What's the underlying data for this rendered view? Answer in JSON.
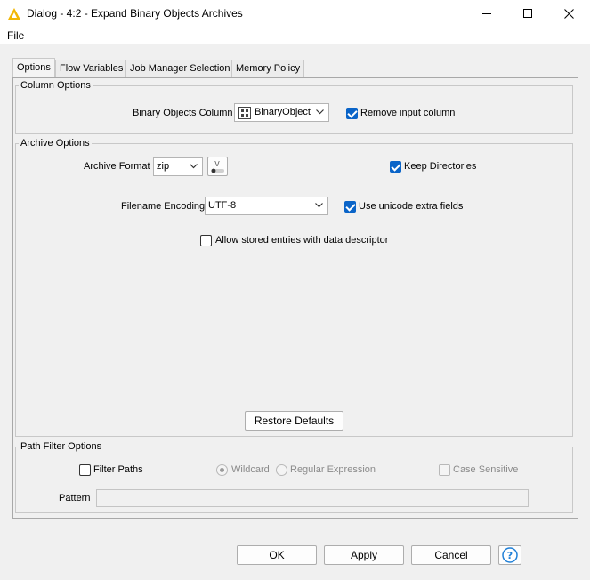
{
  "window": {
    "title": "Dialog - 4:2 - Expand Binary Objects Archives"
  },
  "menu": {
    "file": "File"
  },
  "tabs": [
    {
      "label": "Options",
      "active": true
    },
    {
      "label": "Flow Variables",
      "active": false
    },
    {
      "label": "Job Manager Selection",
      "active": false
    },
    {
      "label": "Memory Policy",
      "active": false
    }
  ],
  "column_options": {
    "title": "Column Options",
    "binary_column_label": "Binary Objects Column",
    "binary_column_value": "BinaryObject",
    "remove_input_label": "Remove input column",
    "remove_input_checked": true
  },
  "archive_options": {
    "title": "Archive Options",
    "format_label": "Archive Format",
    "format_value": "zip",
    "keep_dirs_label": "Keep Directories",
    "keep_dirs_checked": true,
    "encoding_label": "Filename Encoding",
    "encoding_value": "UTF-8",
    "unicode_label": "Use unicode extra fields",
    "unicode_checked": true,
    "allow_stored_label": "Allow stored entries with data descriptor",
    "allow_stored_checked": false,
    "restore_defaults": "Restore Defaults"
  },
  "path_filter": {
    "title": "Path Filter Options",
    "filter_paths_label": "Filter Paths",
    "filter_paths_checked": false,
    "wildcard_label": "Wildcard",
    "wildcard_selected": true,
    "regex_label": "Regular Expression",
    "regex_selected": false,
    "case_sensitive_label": "Case Sensitive",
    "case_sensitive_checked": false,
    "pattern_label": "Pattern",
    "pattern_value": ""
  },
  "buttons": {
    "ok": "OK",
    "apply": "Apply",
    "cancel": "Cancel"
  },
  "colors": {
    "accent": "#0a64c8",
    "app_icon": "#f2b705",
    "help_icon": "#1f7fd6"
  }
}
